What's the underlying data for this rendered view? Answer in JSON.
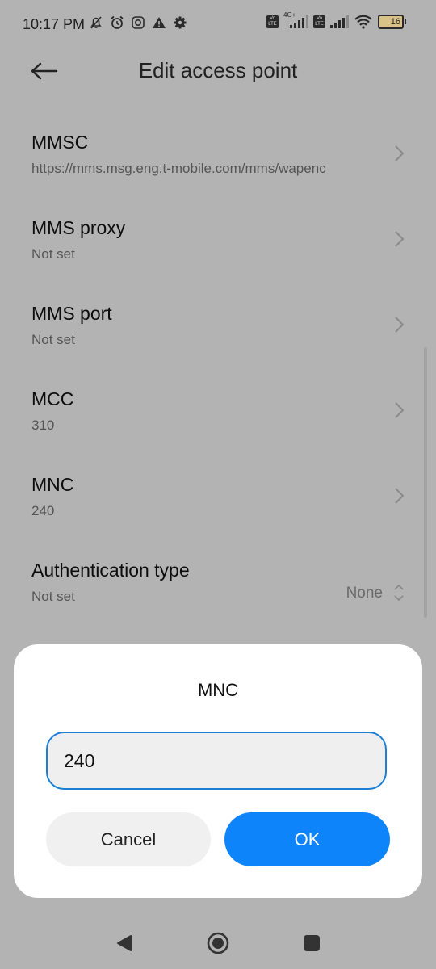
{
  "status_bar": {
    "time": "10:17 PM",
    "left_icons": [
      "bell-off-icon",
      "alarm-icon",
      "instagram-icon",
      "warning-icon",
      "gear-icon"
    ],
    "sim1_badge": "Vo LTE",
    "sim1_network": "4G+",
    "sim2_badge": "Vo LTE",
    "battery_level": "16"
  },
  "header": {
    "title": "Edit access point",
    "back_icon": "arrow-left-icon"
  },
  "list": {
    "items": [
      {
        "title": "MMSC",
        "subtitle": "https://mms.msg.eng.t-mobile.com/mms/wapenc"
      },
      {
        "title": "MMS proxy",
        "subtitle": "Not set"
      },
      {
        "title": "MMS port",
        "subtitle": "Not set"
      },
      {
        "title": "MCC",
        "subtitle": "310"
      },
      {
        "title": "MNC",
        "subtitle": "240"
      },
      {
        "title": "Authentication type",
        "subtitle": "Not set",
        "value": "None"
      }
    ]
  },
  "dialog": {
    "title": "MNC",
    "input_value": "240",
    "cancel_label": "Cancel",
    "ok_label": "OK",
    "accent_color": "#0d84fa"
  },
  "navbar": {
    "back": "back-triangle-icon",
    "home": "home-circle-icon",
    "recents": "recents-square-icon"
  }
}
